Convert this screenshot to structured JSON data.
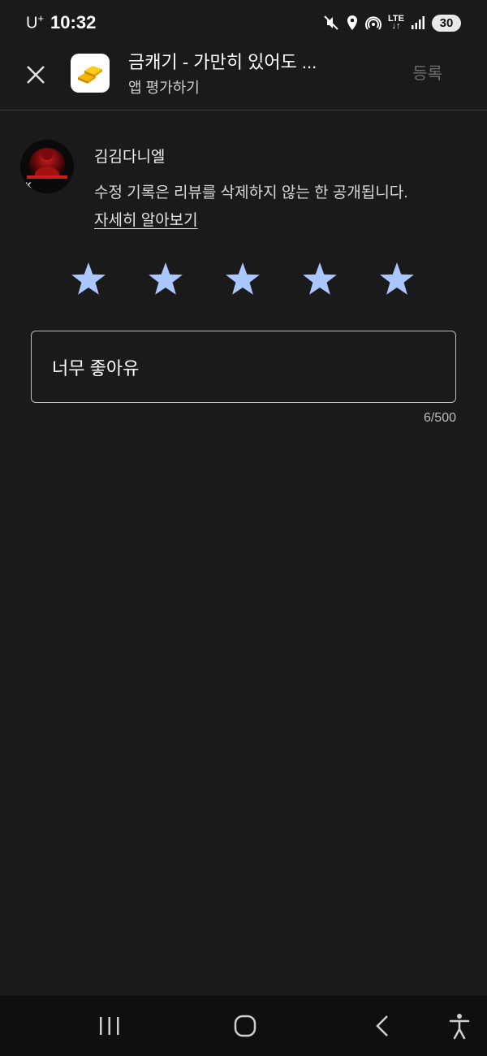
{
  "status_bar": {
    "carrier": "U",
    "carrier_sup": "+",
    "time": "10:32",
    "network": "LTE",
    "battery": "30",
    "icons": [
      "mute-icon",
      "location-icon",
      "hotspot-icon",
      "signal-icon"
    ]
  },
  "header": {
    "app_title": "금캐기 - 가만히 있어도 ...",
    "subtitle": "앱 평가하기",
    "submit_label": "등록",
    "icons": [
      "close-icon",
      "app-icon-gold-bars"
    ]
  },
  "review": {
    "user_name": "김김다니엘",
    "notice": "수정 기록은 리뷰를 삭제하지 않는 한 공개됩니다.",
    "learn_more": "자세히 알아보기",
    "avatar_badge": "K",
    "rating": 5,
    "max_rating": 5,
    "star_color": "#aac7ff",
    "text": "너무 좋아유",
    "char_count": "6/500"
  },
  "nav_bar": {
    "icons": [
      "recents-icon",
      "home-icon",
      "back-icon",
      "accessibility-icon"
    ]
  }
}
